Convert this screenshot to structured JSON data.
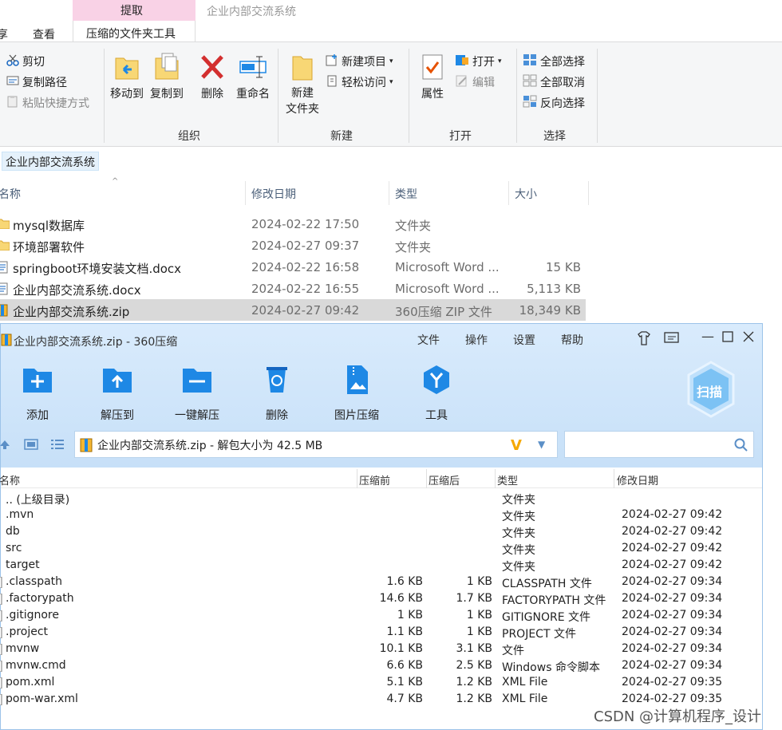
{
  "ribbon": {
    "context_tab": "提取",
    "window_title": "企业内部交流系统",
    "tabs": [
      "享",
      "查看",
      "压缩的文件夹工具"
    ],
    "clipboard": {
      "cut": "剪切",
      "copy_path": "复制路径",
      "paste_shortcut": "粘贴快捷方式"
    },
    "organize": {
      "move_to": "移动到",
      "copy_to": "复制到",
      "delete": "删除",
      "rename": "重命名",
      "label": "组织"
    },
    "new": {
      "new_folder_line1": "新建",
      "new_folder_line2": "文件夹",
      "new_item": "新建项目",
      "easy_access": "轻松访问",
      "label": "新建"
    },
    "open": {
      "properties": "属性",
      "open": "打开",
      "edit": "编辑",
      "label": "打开"
    },
    "select": {
      "select_all": "全部选择",
      "select_none": "全部取消",
      "invert": "反向选择",
      "label": "选择"
    }
  },
  "address": {
    "crumb": "企业内部交流系统"
  },
  "explorer": {
    "columns": {
      "name": "名称",
      "date": "修改日期",
      "type": "类型",
      "size": "大小"
    },
    "rows": [
      {
        "name": "mysql数据库",
        "date": "2024-02-22 17:50",
        "type": "文件夹",
        "size": "",
        "icon": "folder"
      },
      {
        "name": "环境部署软件",
        "date": "2024-02-27 09:37",
        "type": "文件夹",
        "size": "",
        "icon": "folder"
      },
      {
        "name": "springboot环境安装文档.docx",
        "date": "2024-02-22 16:58",
        "type": "Microsoft Word ...",
        "size": "15 KB",
        "icon": "doc"
      },
      {
        "name": "企业内部交流系统.docx",
        "date": "2024-02-22 16:55",
        "type": "Microsoft Word ...",
        "size": "5,113 KB",
        "icon": "doc"
      },
      {
        "name": "企业内部交流系统.zip",
        "date": "2024-02-27 09:42",
        "type": "360压缩 ZIP 文件",
        "size": "18,349 KB",
        "icon": "zip",
        "selected": true
      }
    ]
  },
  "zip_window": {
    "title": "企业内部交流系统.zip - 360压缩",
    "menu": [
      "文件",
      "操作",
      "设置",
      "帮助"
    ],
    "tools": [
      "添加",
      "解压到",
      "一键解压",
      "删除",
      "图片压缩",
      "工具"
    ],
    "scan_label": "扫描",
    "path_text": "企业内部交流系统.zip - 解包大小为 42.5 MB",
    "columns": {
      "name": "名称",
      "before": "压缩前",
      "after": "压缩后",
      "type": "类型",
      "date": "修改日期"
    },
    "rows": [
      {
        "name": ".. (上级目录)",
        "before": "",
        "after": "",
        "type": "文件夹",
        "date": ""
      },
      {
        "name": ".mvn",
        "before": "",
        "after": "",
        "type": "文件夹",
        "date": "2024-02-27 09:42"
      },
      {
        "name": "db",
        "before": "",
        "after": "",
        "type": "文件夹",
        "date": "2024-02-27 09:42"
      },
      {
        "name": "src",
        "before": "",
        "after": "",
        "type": "文件夹",
        "date": "2024-02-27 09:42"
      },
      {
        "name": "target",
        "before": "",
        "after": "",
        "type": "文件夹",
        "date": "2024-02-27 09:42"
      },
      {
        "name": ".classpath",
        "before": "1.6 KB",
        "after": "1 KB",
        "type": "CLASSPATH 文件",
        "date": "2024-02-27 09:34"
      },
      {
        "name": ".factorypath",
        "before": "14.6 KB",
        "after": "1.7 KB",
        "type": "FACTORYPATH 文件",
        "date": "2024-02-27 09:34"
      },
      {
        "name": ".gitignore",
        "before": "1 KB",
        "after": "1 KB",
        "type": "GITIGNORE 文件",
        "date": "2024-02-27 09:34"
      },
      {
        "name": ".project",
        "before": "1.1 KB",
        "after": "1 KB",
        "type": "PROJECT 文件",
        "date": "2024-02-27 09:34"
      },
      {
        "name": "mvnw",
        "before": "10.1 KB",
        "after": "3.1 KB",
        "type": "文件",
        "date": "2024-02-27 09:34"
      },
      {
        "name": "mvnw.cmd",
        "before": "6.6 KB",
        "after": "2.5 KB",
        "type": "Windows 命令脚本",
        "date": "2024-02-27 09:34"
      },
      {
        "name": "pom.xml",
        "before": "5.1 KB",
        "after": "1.2 KB",
        "type": "XML File",
        "date": "2024-02-27 09:35"
      },
      {
        "name": "pom-war.xml",
        "before": "4.7 KB",
        "after": "1.2 KB",
        "type": "XML File",
        "date": "2024-02-27 09:35"
      }
    ]
  },
  "watermark": "CSDN @计算机程序_设计",
  "colors": {
    "context_tab": "#f9d2e6",
    "selection": "#d9d9d9",
    "zip_blue": "#1e88e5"
  }
}
